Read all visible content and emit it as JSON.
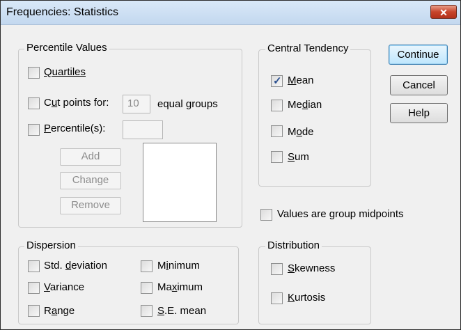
{
  "window": {
    "title": "Frequencies: Statistics",
    "close_icon": "close-icon",
    "close_glyph": "✕"
  },
  "percentile_values": {
    "legend": "Percentile Values",
    "quartiles": {
      "label": "Quartiles",
      "checked": false
    },
    "cut_points": {
      "label_pre": "C",
      "label_ul": "u",
      "label_post": "t points for:",
      "value": "10",
      "suffix": "equal groups",
      "checked": false
    },
    "percentiles": {
      "label_pre": "",
      "label_ul": "P",
      "label_post": "ercentile(s):",
      "value": "",
      "checked": false
    },
    "add_label": "Add",
    "change_label": "Change",
    "remove_label": "Remove"
  },
  "central_tendency": {
    "legend": "Central Tendency",
    "mean": {
      "label_ul": "M",
      "label_post": "ean",
      "checked": true
    },
    "median": {
      "label_pre": "Me",
      "label_ul": "d",
      "label_post": "ian",
      "checked": false
    },
    "mode": {
      "label_pre": "M",
      "label_ul": "o",
      "label_post": "de",
      "checked": false
    },
    "sum": {
      "label_ul": "S",
      "label_post": "um",
      "checked": false
    }
  },
  "buttons": {
    "continue": "Continue",
    "cancel": "Cancel",
    "help": "Help"
  },
  "group_midpoints": {
    "label_pre": "Values are ",
    "label_ul": "g",
    "label_post": "roup midpoints",
    "checked": false
  },
  "dispersion": {
    "legend": "Dispersion",
    "std_deviation": {
      "label_pre": "Std. ",
      "label_ul": "d",
      "label_post": "eviation",
      "checked": false
    },
    "variance": {
      "label_ul": "V",
      "label_post": "ariance",
      "checked": false
    },
    "range": {
      "label_pre": "R",
      "label_ul": "a",
      "label_post": "nge",
      "checked": false
    },
    "minimum": {
      "label_pre": "M",
      "label_ul": "i",
      "label_post": "nimum",
      "checked": false
    },
    "maximum": {
      "label_pre": "Ma",
      "label_ul": "x",
      "label_post": "imum",
      "checked": false
    },
    "se_mean": {
      "label_ul": "S",
      "label_post": ".E. mean",
      "checked": false
    }
  },
  "distribution": {
    "legend": "Distribution",
    "skewness": {
      "label_ul": "S",
      "label_post": "kewness",
      "checked": false
    },
    "kurtosis": {
      "label_ul": "K",
      "label_post": "urtosis",
      "checked": false
    }
  }
}
